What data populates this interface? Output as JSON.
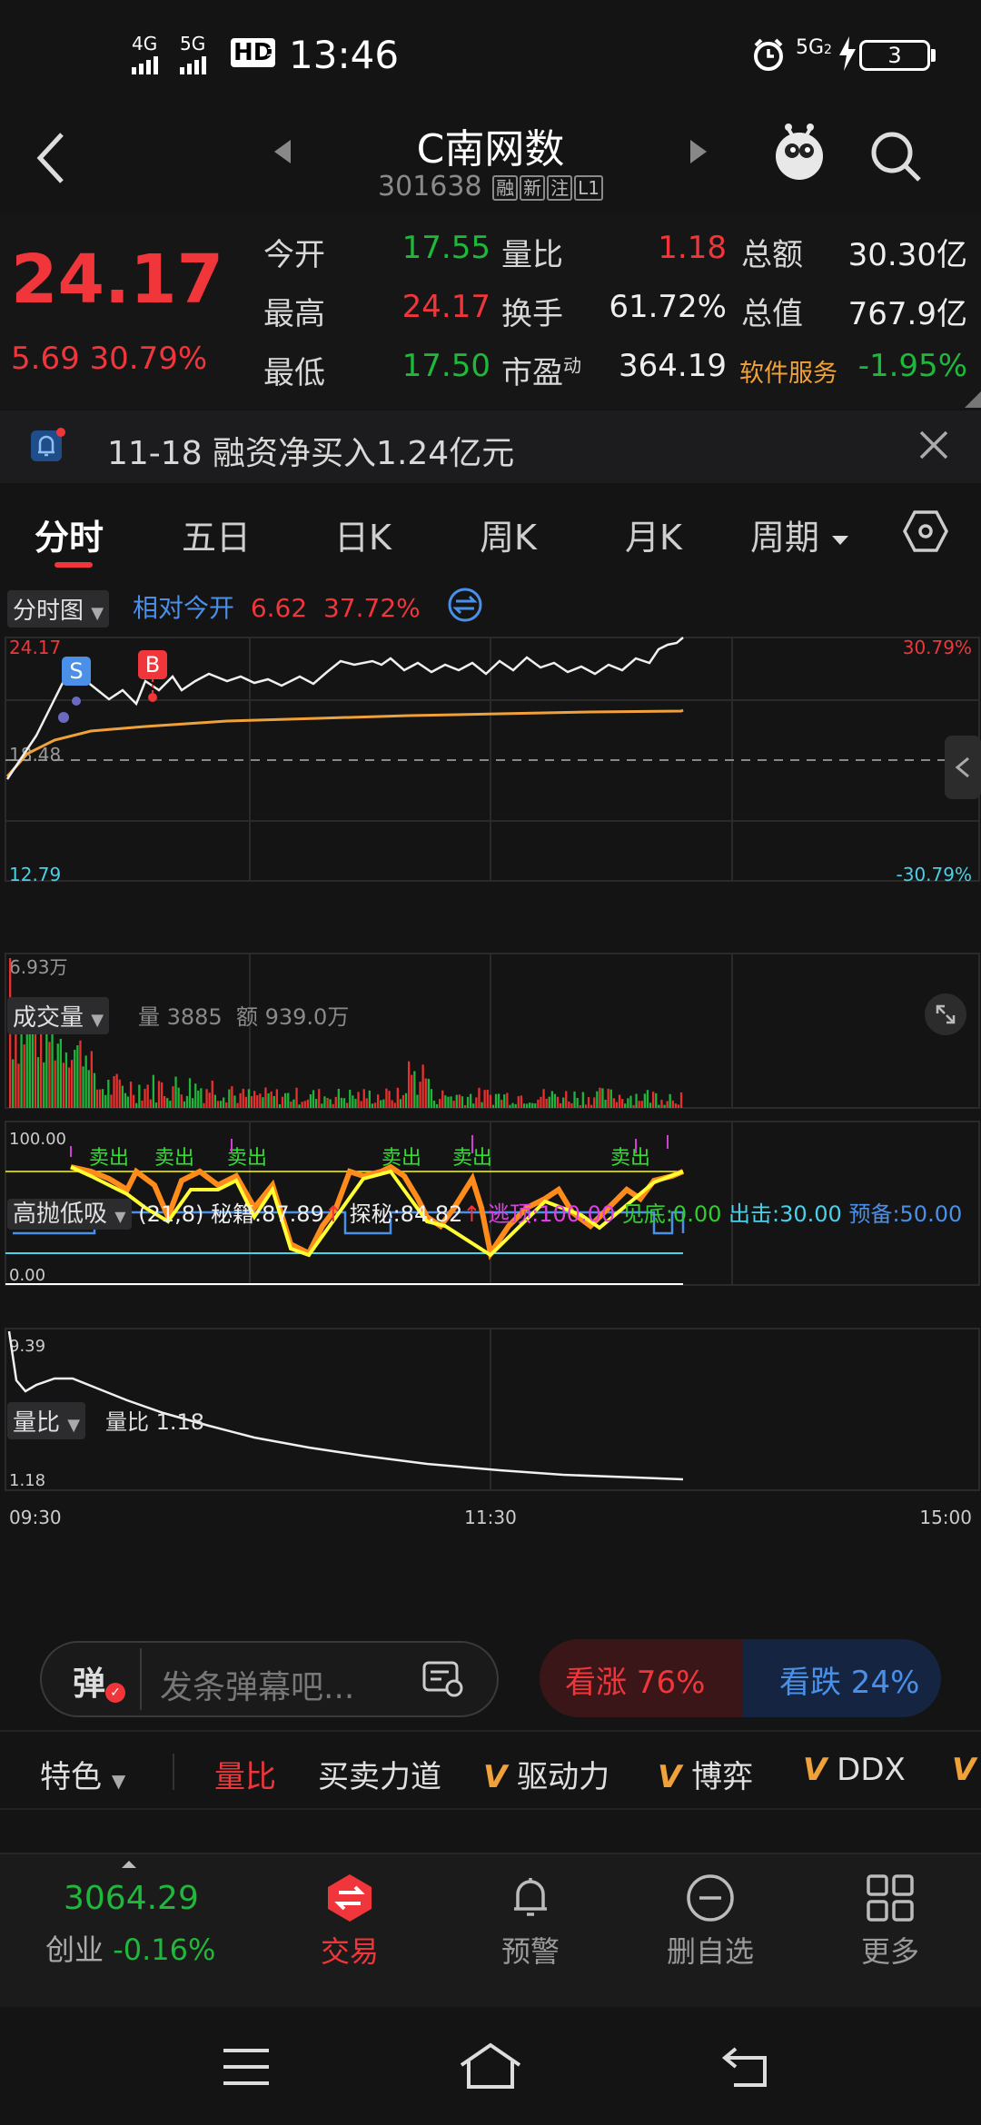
{
  "status": {
    "net1": "4G",
    "net2": "5G",
    "hd": "HD",
    "hd_sub": "1",
    "hd_sub2": "2",
    "time": "13:46",
    "net3": "5G",
    "battery": "3"
  },
  "nav": {
    "name": "C南网数",
    "code": "301638",
    "tags": [
      "融",
      "新",
      "注",
      "L1"
    ]
  },
  "quote": {
    "price": "24.17",
    "change_abs": "5.69",
    "change_pct": "30.79%",
    "rows": [
      [
        {
          "label": "今开",
          "value": "17.55"
        },
        {
          "label": "量比",
          "value": "1.18"
        },
        {
          "label": "总额",
          "value": "30.30亿"
        }
      ],
      [
        {
          "label": "最高",
          "value": "24.17"
        },
        {
          "label": "换手",
          "value": "61.72%"
        },
        {
          "label": "总值",
          "value": "767.9亿"
        }
      ],
      [
        {
          "label": "最低",
          "value": "17.50"
        },
        {
          "label": "市盈",
          "label_sup": "动",
          "value": "364.19"
        },
        {
          "label": "软件服务",
          "value": "-1.95%"
        }
      ]
    ]
  },
  "notice": {
    "text": "11-18 融资净买入1.24亿元"
  },
  "tabs": [
    "分时",
    "五日",
    "日K",
    "周K",
    "月K",
    "周期"
  ],
  "intraday": {
    "selector": "分时图",
    "relative_label": "相对今开",
    "relative_value": "6.62",
    "relative_pct": "37.72%",
    "y_top": "24.17",
    "y_mid": "18.48",
    "y_bottom": "12.79",
    "pct_top": "30.79%",
    "pct_bottom": "-30.79%",
    "marker_s": "S",
    "marker_b": "B"
  },
  "volume": {
    "selector": "成交量",
    "vol_label": "量 3885",
    "amt_label": "额 939.0万",
    "y_top": "6.93万"
  },
  "gaopao": {
    "selector": "高抛低吸",
    "params": "(21,8)",
    "miji": "秘籍:87.89",
    "tanmi": "探秘:84.82",
    "taoding": "逃顶:100.00",
    "jiandi": "见底:0.00",
    "chuji": "出击:30.00",
    "yubei": "预备:50.00",
    "y_top": "100.00",
    "y_bottom": "0.00",
    "sell_label": "卖出"
  },
  "liangbi": {
    "selector": "量比",
    "value_label": "量比 1.18",
    "y_top": "9.39",
    "y_bottom": "1.18"
  },
  "time_axis": [
    "09:30",
    "11:30",
    "15:00"
  ],
  "danmu": {
    "icon_char": "弹",
    "placeholder": "发条弹幕吧..."
  },
  "vote": {
    "up": "看涨 76%",
    "down": "看跌 24%"
  },
  "ind_tabs": [
    "特色",
    "量比",
    "买卖力道",
    "驱动力",
    "博弈",
    "DDX"
  ],
  "bottom": {
    "index_value": "3064.29",
    "index_name": "创业",
    "index_change": "-0.16%",
    "items": [
      "交易",
      "预警",
      "删自选",
      "更多"
    ]
  }
}
